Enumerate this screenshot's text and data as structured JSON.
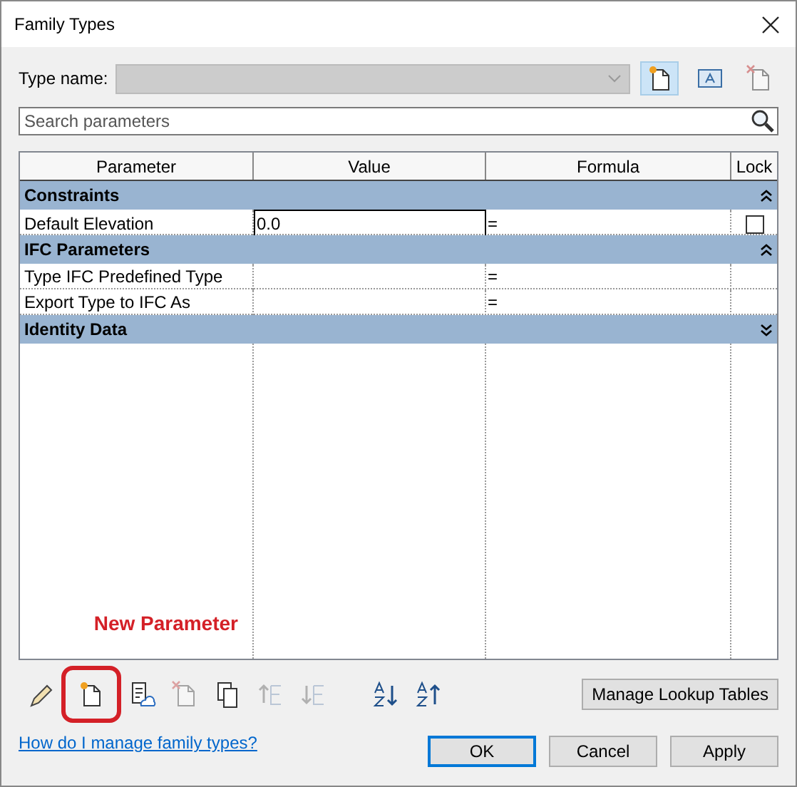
{
  "window": {
    "title": "Family Types"
  },
  "type_name": {
    "label": "Type name:",
    "disabled": true
  },
  "type_tools": [
    {
      "kind": "new",
      "selected": true,
      "disabled": false
    },
    {
      "kind": "rename",
      "selected": false,
      "disabled": false
    },
    {
      "kind": "delete",
      "selected": false,
      "disabled": true
    }
  ],
  "search": {
    "placeholder": "Search parameters"
  },
  "table": {
    "columns": [
      "Parameter",
      "Value",
      "Formula",
      "Lock"
    ],
    "groups": [
      {
        "name": "Constraints",
        "expanded": true,
        "rows": [
          {
            "parameter": "Default Elevation",
            "value": "0.0",
            "editing": true,
            "formula": "=",
            "lock": {
              "checked": false
            }
          }
        ]
      },
      {
        "name": "IFC Parameters",
        "expanded": true,
        "rows": [
          {
            "parameter": "Type IFC Predefined Type",
            "editing": false,
            "formula": "="
          },
          {
            "parameter": "Export Type to IFC As",
            "editing": false,
            "formula": "="
          }
        ]
      },
      {
        "name": "Identity Data",
        "expanded": false
      }
    ]
  },
  "annotation": {
    "text": "New Parameter"
  },
  "tools": [
    {
      "kind": "edit",
      "disabled": false,
      "highlighted": false
    },
    {
      "kind": "new",
      "disabled": false,
      "highlighted": true
    },
    {
      "kind": "shared",
      "disabled": false,
      "highlighted": false
    },
    {
      "kind": "delete",
      "disabled": true,
      "highlighted": false
    },
    {
      "kind": "copy",
      "disabled": false,
      "highlighted": false
    },
    {
      "kind": "up",
      "disabled": true,
      "highlighted": false
    },
    {
      "kind": "down",
      "disabled": true,
      "highlighted": false
    },
    {
      "kind": "sort_asc",
      "disabled": false,
      "highlighted": false
    },
    {
      "kind": "sort_desc",
      "disabled": false,
      "highlighted": false
    }
  ],
  "lookup_button": "Manage Lookup Tables",
  "help_link": "How do I manage family types?",
  "buttons": [
    {
      "label": "OK",
      "default": true
    },
    {
      "label": "Cancel",
      "default": false
    },
    {
      "label": "Apply",
      "default": false
    }
  ]
}
